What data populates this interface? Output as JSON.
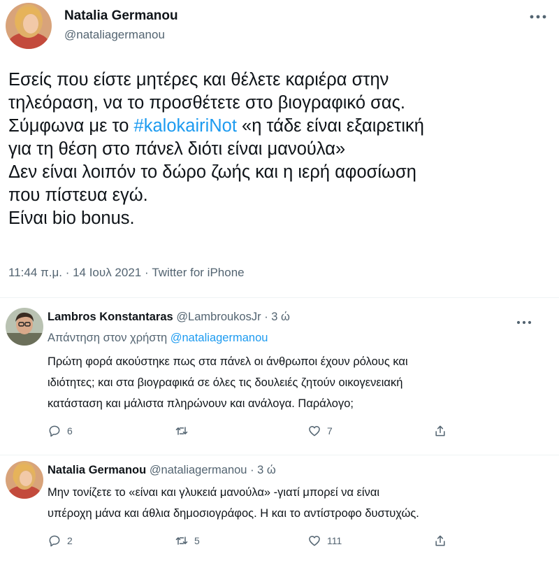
{
  "main_tweet": {
    "author_name": "Natalia Germanou",
    "author_handle": "@nataliagermanou",
    "body_lines": [
      "Εσείς που είστε μητέρες και θέλετε καριέρα στην",
      "τηλεόραση, να το προσθέτετε στο βιογραφικό σας."
    ],
    "body_line3_prefix": "Σύμφωνα με το ",
    "hashtag": "#kalokairiNot",
    "body_line3_suffix": " «η τάδε είναι εξαιρετική",
    "body_lines_after": [
      "για τη θέση στο πάνελ διότι είναι μανούλα»",
      "Δεν είναι λοιπόν το δώρο ζωής και η ιερή αφοσίωση",
      "που πίστευα εγώ.",
      "Είναι bio bonus."
    ],
    "meta": "11:44 π.μ. · 14 Ιουλ 2021 · Twitter for iPhone"
  },
  "replies": [
    {
      "author_name": "Lambros Konstantaras",
      "author_handle": "@LambroukosJr",
      "time": " · 3 ώ",
      "reply_to_label": "Απάντηση στον χρήστη ",
      "reply_to_mention": "@nataliagermanou",
      "body_lines": [
        "Πρώτη φορά ακούστηκε πως στα πάνελ οι άνθρωποι έχουν ρόλους και",
        "ιδιότητες; και στα  βιογραφικά σε όλες τις δουλειές ζητούν οικογενειακή",
        "κατάσταση και μάλιστα πληρώνουν και ανάλογα. Παράλογο;"
      ],
      "replies_count": "6",
      "retweets_count": "",
      "likes_count": "7"
    },
    {
      "author_name": "Natalia Germanou",
      "author_handle": "@nataliagermanou",
      "time": " · 3 ώ",
      "body_lines": [
        "Μην τονίζετε το «είναι και γλυκειά μανούλα» -γιατί μπορεί να είναι",
        "υπέροχη μάνα και άθλια δημοσιογράφος. Η και το αντίστροφο δυστυχώς."
      ],
      "replies_count": "2",
      "retweets_count": "5",
      "likes_count": "111"
    }
  ],
  "icons": {
    "more": "more-dots-icon",
    "reply": "reply-bubble-icon",
    "retweet": "retweet-icon",
    "like": "heart-icon",
    "share": "share-icon"
  },
  "colors": {
    "link": "#1d9bf0",
    "secondary_text": "#536471",
    "primary_text": "#0f1419",
    "divider": "#eff3f4"
  }
}
